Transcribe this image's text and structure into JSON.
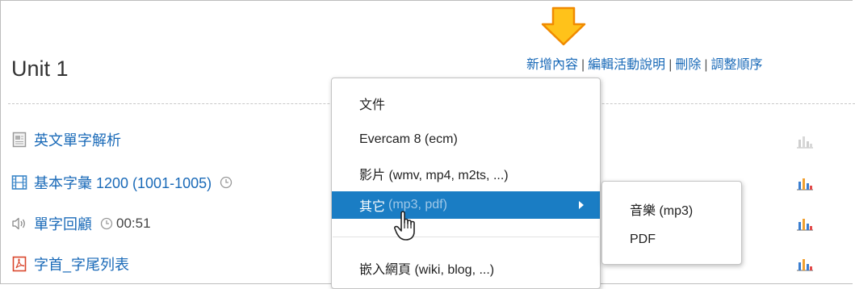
{
  "unit": {
    "title": "Unit 1"
  },
  "actions": {
    "add_content": "新增內容",
    "edit_description": "編輯活動說明",
    "delete": "刪除",
    "reorder": "調整順序",
    "separator": "|"
  },
  "items": [
    {
      "title": "英文單字解析",
      "icon": "document-icon",
      "has_clock": false,
      "duration": ""
    },
    {
      "title": "基本字彙 1200 (1001-1005)",
      "icon": "film-icon",
      "has_clock": true,
      "duration": ""
    },
    {
      "title": "單字回顧",
      "icon": "speaker-icon",
      "has_clock": true,
      "duration": "00:51"
    },
    {
      "title": "字首_字尾列表",
      "icon": "pdf-icon",
      "has_clock": false,
      "duration": ""
    }
  ],
  "menu": {
    "items": [
      {
        "label": "文件",
        "hint": ""
      },
      {
        "label": "Evercam 8 (ecm)",
        "hint": ""
      },
      {
        "label": "影片 (wmv, mp4, m2ts, ...)",
        "hint": ""
      },
      {
        "label": "其它",
        "hint": "(mp3, pdf)"
      },
      {
        "label": "嵌入網頁 (wiki, blog, ...)",
        "hint": ""
      }
    ]
  },
  "submenu": {
    "items": [
      {
        "label": "音樂 (mp3)"
      },
      {
        "label": "PDF"
      }
    ]
  },
  "colors": {
    "link": "#1a6ab8",
    "highlight": "#1a7dc4",
    "arrow": "#ffc21a",
    "arrow_stroke": "#f08a00"
  }
}
